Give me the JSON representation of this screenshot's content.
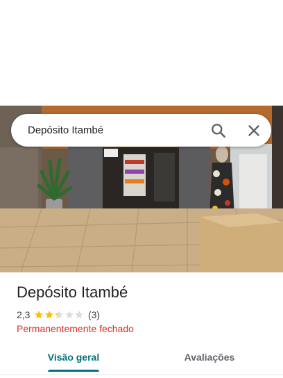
{
  "search": {
    "query": "Depósito Itambé",
    "icons": {
      "search": "search-icon",
      "close": "close-icon"
    }
  },
  "place": {
    "name": "Depósito Itambé",
    "rating": "2,3",
    "rating_value": 2.3,
    "max_rating": 5,
    "review_count": "(3)",
    "status": "Permanentemente fechado"
  },
  "tabs": [
    {
      "label": "Visão geral",
      "selected": true
    },
    {
      "label": "Avaliações",
      "selected": false
    }
  ],
  "colors": {
    "accent": "#00737a",
    "status_closed": "#d93025",
    "star_filled": "#fbbc04",
    "star_empty": "#dadce0"
  }
}
